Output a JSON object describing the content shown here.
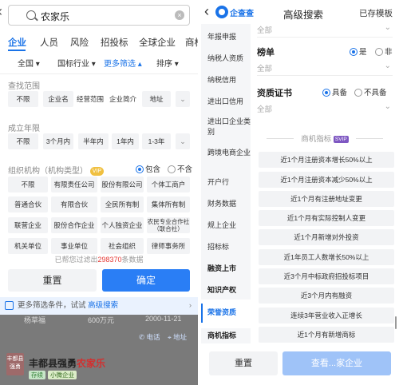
{
  "left": {
    "search_query": "农家乐",
    "tabs": [
      "企业",
      "人员",
      "风险",
      "招投标",
      "全球企业",
      "商标"
    ],
    "filters": {
      "region": "全国",
      "industry": "国标行业",
      "more": "更多筛选",
      "sort": "排序"
    },
    "scope": {
      "title": "查找范围",
      "options": [
        "不限",
        "企业名",
        "经营范围",
        "企业简介",
        "地址"
      ]
    },
    "founded": {
      "title": "成立年限",
      "options": [
        "不限",
        "3个月内",
        "半年内",
        "1年内",
        "1-3年"
      ]
    },
    "org": {
      "title": "组织机构（机构类型）",
      "vip": "VIP",
      "include": "包含",
      "exclude": "不含",
      "options": [
        "不限",
        "有限责任公司",
        "股份有限公司",
        "个体工商户",
        "普通合伙",
        "有限合伙",
        "全民所有制",
        "集体所有制",
        "联营企业",
        "股份合作企业",
        "个人独资企业",
        "农民专业合作社（联合社）",
        "机关单位",
        "事业单位",
        "社会组织",
        "律师事务所"
      ]
    },
    "count": {
      "prefix": "已帮您过滤出",
      "value": "298370",
      "suffix": "条数据"
    },
    "reset": "重置",
    "confirm": "确定",
    "more_bar": {
      "text": "更多筛选条件，试试",
      "link": "高级搜索"
    },
    "bg": {
      "legal_partial": "杨草福",
      "capital": "600万元",
      "date": "2000-11-21",
      "phone": "电话",
      "address": "地址",
      "logo_text": "丰都县强勇",
      "company_name_prefix": "丰都县强勇",
      "company_name_hl": "农家乐",
      "status": "存续",
      "type": "小微企业"
    }
  },
  "right": {
    "back": "<",
    "brand": "企查查",
    "title": "高级搜索",
    "save_template": "已存模板",
    "sidebar": [
      "年报申报",
      "纳税人资质",
      "纳税信用",
      "进出口信用",
      "进出口企业类别",
      "跨境电商企业",
      "开户行",
      "财务数据",
      "规上企业",
      "招标标",
      "融资上市",
      "知识产权",
      "荣誉资质",
      "商机指标"
    ],
    "top_partial": "全部",
    "list": {
      "title": "榜单",
      "yes": "是",
      "no": "非",
      "all": "全部"
    },
    "cert": {
      "title": "资质证书",
      "has": "具备",
      "not_has": "不具备",
      "all": "全部"
    },
    "biz": {
      "title": "商机指标",
      "vip": "SVIP",
      "items": [
        "近1个月注册资本增长50%以上",
        "近1个月注册资本减少50%以上",
        "近1个月有注册地址变更",
        "近1个月有实际控制人变更",
        "近1个月新增对外投资",
        "近1年员工人数增长50%以上",
        "近3个月中标政府招投标项目",
        "近3个月内有融资",
        "连续3年营业收入正增长",
        "近1个月有新增商标"
      ]
    },
    "reset": "重置",
    "view": "查看...家企业"
  }
}
